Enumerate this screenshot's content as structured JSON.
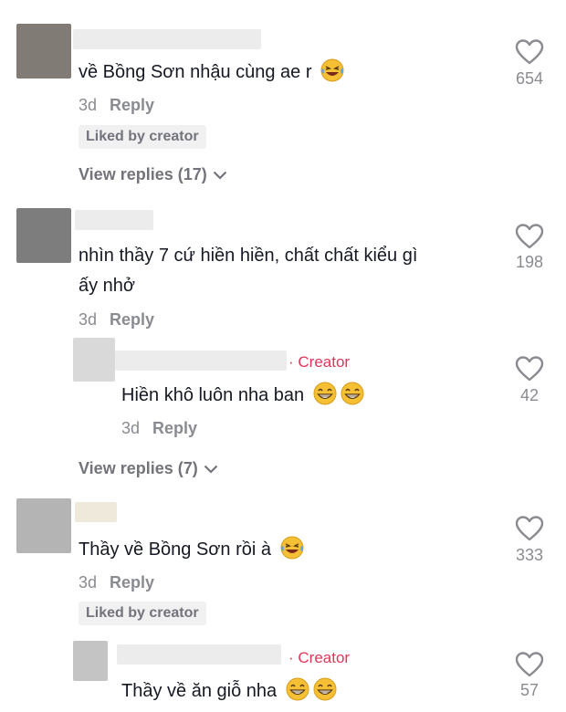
{
  "comments": [
    {
      "text": "về Bồng Sơn nhậu cùng ae r",
      "emoji": "laughing-tears",
      "time": "3d",
      "reply": "Reply",
      "liked": "Liked by creator",
      "likes": "654",
      "view_replies": "View replies (17)"
    },
    {
      "text_line1": "nhìn thầy 7 cứ hiền hiền, chất chất kiểu gì",
      "text_line2": "ấy nhở",
      "time": "3d",
      "reply": "Reply",
      "likes": "198",
      "view_replies": "View replies (7)",
      "creator_reply": {
        "badge": "· Creator",
        "text": "Hiền khô luôn nha ban",
        "time": "3d",
        "reply": "Reply",
        "likes": "42"
      }
    },
    {
      "text": "Thầy về Bồng Sơn rồi à",
      "time": "3d",
      "reply": "Reply",
      "liked": "Liked by creator",
      "likes": "333",
      "creator_reply": {
        "badge": "· Creator",
        "text": "Thầy về ăn giỗ nha",
        "likes": "57"
      }
    }
  ],
  "colors": {
    "creator": "#e1345a",
    "muted": "#8a8b91",
    "text": "#161823"
  }
}
